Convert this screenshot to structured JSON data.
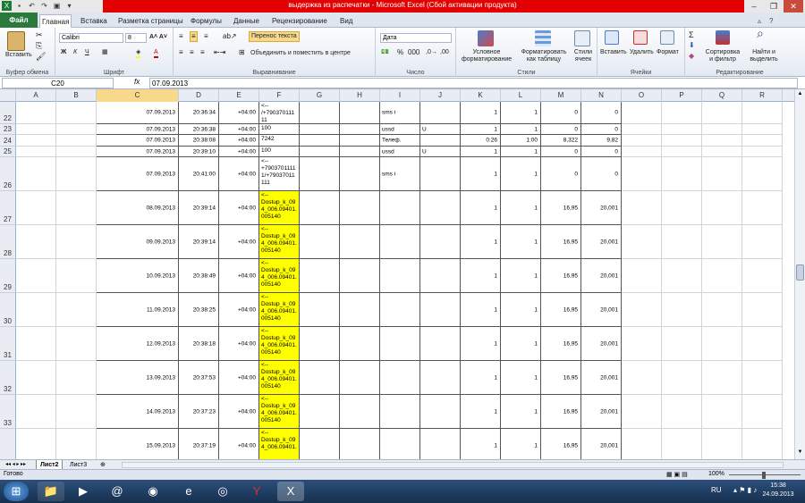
{
  "window": {
    "title": "выдержка из распечатки  -  Microsoft Excel (Сбой активации продукта)"
  },
  "ribbon_tabs": {
    "file": "Файл",
    "items": [
      "Главная",
      "Вставка",
      "Разметка страницы",
      "Формулы",
      "Данные",
      "Рецензирование",
      "Вид"
    ]
  },
  "ribbon": {
    "paste": "Вставить",
    "clipboard": "Буфер обмена",
    "font_name": "Calibri",
    "font_size": "8",
    "font_group": "Шрифт",
    "wrap_text": "Перенос текста",
    "merge_center": "Объединить и поместить в центре",
    "alignment_group": "Выравнивание",
    "number_format": "Дата",
    "number_group": "Число",
    "cond_format": "Условное форматирование",
    "format_table": "Форматировать как таблицу",
    "cell_styles": "Стили ячеек",
    "styles_group": "Стили",
    "insert": "Вставить",
    "delete": "Удалить",
    "format": "Формат",
    "cells_group": "Ячейки",
    "sort_filter": "Сортировка и фильтр",
    "find_select": "Найти и выделить",
    "editing_group": "Редактирование"
  },
  "formula_bar": {
    "name_box": "C20",
    "fx": "fx",
    "value": "07.09.2013"
  },
  "columns": [
    "A",
    "B",
    "C",
    "D",
    "E",
    "F",
    "G",
    "H",
    "I",
    "J",
    "K",
    "L",
    "M",
    "N",
    "O",
    "P",
    "Q",
    "R"
  ],
  "rows": [
    {
      "num": "22",
      "C": "07.09.2013",
      "D": "20:36:34",
      "E": "+04:00",
      "F": "<--\n/+790370111\n11",
      "I": "sms i",
      "J": "",
      "K": "1",
      "L": "1",
      "M": "0",
      "N": "0"
    },
    {
      "num": "23",
      "C": "07.09.2013",
      "D": "20:36:38",
      "E": "+04:00",
      "F": "100",
      "I": "ussd",
      "J": "U",
      "K": "1",
      "L": "1",
      "M": "0",
      "N": "0"
    },
    {
      "num": "24",
      "C": "07.09.2013",
      "D": "20:38:08",
      "E": "+04:00",
      "F": "7242",
      "I": "Телеф.",
      "J": "",
      "K": "0:26",
      "L": "1:00",
      "M": "8,322",
      "N": "9,82"
    },
    {
      "num": "25",
      "C": "07.09.2013",
      "D": "20:39:10",
      "E": "+04:00",
      "F": "100",
      "I": "ussd",
      "J": "U",
      "K": "1",
      "L": "1",
      "M": "0",
      "N": "0"
    },
    {
      "num": "26",
      "C": "07.09.2013",
      "D": "20:41:00",
      "E": "+04:00",
      "F": "<--\n+7903701111\n1/+79037011\n111",
      "I": "sms i",
      "J": "",
      "K": "1",
      "L": "1",
      "M": "0",
      "N": "0"
    },
    {
      "num": "27",
      "C": "08.09.2013",
      "D": "20:39:14",
      "E": "+04:00",
      "F": "<--\nDostup_k_09\n4_006.09401.\n005140",
      "I": "",
      "J": "",
      "K": "1",
      "L": "1",
      "M": "16,95",
      "N": "20,001"
    },
    {
      "num": "28",
      "C": "09.09.2013",
      "D": "20:39:14",
      "E": "+04:00",
      "F": "<--\nDostup_k_09\n4_006.09401.\n005140",
      "I": "",
      "J": "",
      "K": "1",
      "L": "1",
      "M": "16,95",
      "N": "20,001"
    },
    {
      "num": "29",
      "C": "10.09.2013",
      "D": "20:38:49",
      "E": "+04:00",
      "F": "<--\nDostup_k_09\n4_006.09401.\n005140",
      "I": "",
      "J": "",
      "K": "1",
      "L": "1",
      "M": "16,95",
      "N": "20,001"
    },
    {
      "num": "30",
      "C": "11.09.2013",
      "D": "20:38:25",
      "E": "+04:00",
      "F": "<--\nDostup_k_09\n4_006.09401.\n005140",
      "I": "",
      "J": "",
      "K": "1",
      "L": "1",
      "M": "16,95",
      "N": "20,001"
    },
    {
      "num": "31",
      "C": "12.09.2013",
      "D": "20:38:18",
      "E": "+04:00",
      "F": "<--\nDostup_k_09\n4_006.09401.\n005140",
      "I": "",
      "J": "",
      "K": "1",
      "L": "1",
      "M": "16,95",
      "N": "20,001"
    },
    {
      "num": "32",
      "C": "13.09.2013",
      "D": "20:37:53",
      "E": "+04:00",
      "F": "<--\nDostup_k_09\n4_006.09401.\n005140",
      "I": "",
      "J": "",
      "K": "1",
      "L": "1",
      "M": "16,95",
      "N": "20,001"
    },
    {
      "num": "33",
      "C": "14.09.2013",
      "D": "20:37:23",
      "E": "+04:00",
      "F": "<--\nDostup_k_09\n4_006.09401.\n005140",
      "I": "",
      "J": "",
      "K": "1",
      "L": "1",
      "M": "16,95",
      "N": "20,001"
    },
    {
      "num": "",
      "C": "15.09.2013",
      "D": "20:37:19",
      "E": "+04:00",
      "F": "<--\nDostup_k_09\n4_006.09401.",
      "I": "",
      "J": "",
      "K": "1",
      "L": "1",
      "M": "16,95",
      "N": "20,001"
    }
  ],
  "sheets": [
    "Лист2",
    "Лист3"
  ],
  "status": {
    "ready": "Готово",
    "zoom": "100%"
  },
  "taskbar": {
    "lang": "RU",
    "time": "15:38",
    "date": "24.09.2013"
  },
  "colors": {
    "title_red": "#e30000",
    "file_tab": "#2a7a3c",
    "highlight": "#ffff00",
    "selected_header": "#f8d88b"
  }
}
